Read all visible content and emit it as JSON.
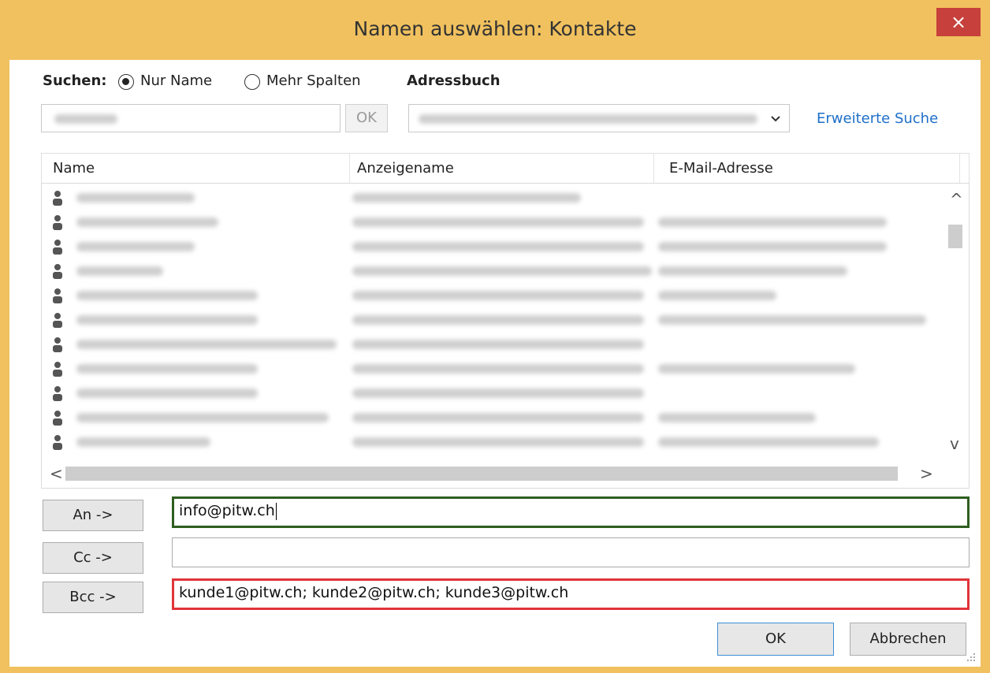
{
  "window": {
    "title": "Namen auswählen: Kontakte",
    "close_glyph": "×"
  },
  "search": {
    "label": "Suchen:",
    "options": [
      {
        "label": "Nur Name",
        "selected": true
      },
      {
        "label": "Mehr Spalten",
        "selected": false
      }
    ],
    "ok_label": "OK"
  },
  "addressbook": {
    "label": "Adressbuch",
    "advanced_search": "Erweiterte Suche"
  },
  "columns": [
    "Name",
    "Anzeigename",
    "E-Mail-Adresse"
  ],
  "contacts": [
    {
      "icon": "contact-person-icon"
    },
    {
      "icon": "contact-person-icon"
    },
    {
      "icon": "contact-person-icon"
    },
    {
      "icon": "contact-person-icon"
    },
    {
      "icon": "contact-person-icon"
    },
    {
      "icon": "contact-person-icon"
    },
    {
      "icon": "contact-person-icon"
    },
    {
      "icon": "contact-person-icon"
    },
    {
      "icon": "contact-person-icon"
    },
    {
      "icon": "contact-person-icon"
    },
    {
      "icon": "contact-person-icon"
    }
  ],
  "scroll": {
    "up": "^",
    "down": "v",
    "left": "<",
    "right": ">"
  },
  "recipients": {
    "to_label": "An ->",
    "to_value": "info@pitw.ch",
    "cc_label": "Cc ->",
    "cc_value": "",
    "bcc_label": "Bcc ->",
    "bcc_value": "kunde1@pitw.ch; kunde2@pitw.ch; kunde3@pitw.ch"
  },
  "footer": {
    "ok_label": "OK",
    "cancel_label": "Abbrechen"
  },
  "colors": {
    "titlebar": "#f0c15e",
    "close": "#c7403b",
    "link": "#1e6fc9",
    "to_highlight": "#2e5e20",
    "bcc_highlight": "#e0343a"
  }
}
